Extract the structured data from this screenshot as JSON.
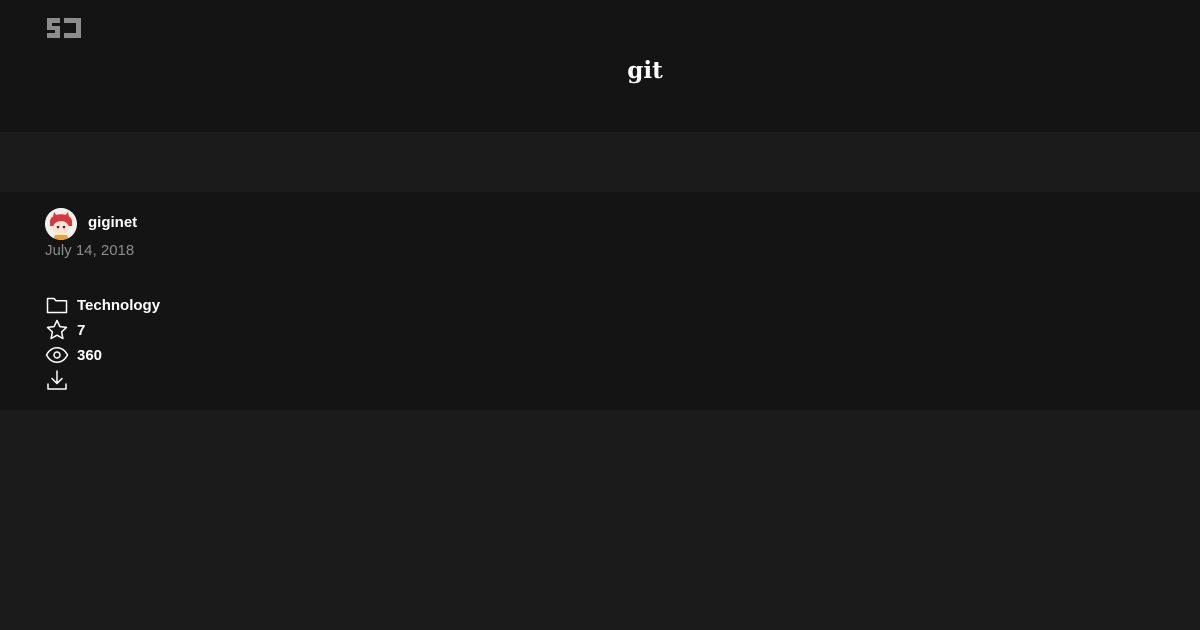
{
  "header": {
    "logo_text": "SJ",
    "title": "git"
  },
  "post": {
    "author": "giginet",
    "date": "July 14, 2018",
    "category": "Technology",
    "stars": "7",
    "views": "360",
    "icons": [
      "folder-icon",
      "star-icon",
      "eye-icon",
      "download-icon"
    ]
  },
  "colors": {
    "header_bg": "#141414",
    "page_bg": "#1b1b1b",
    "text": "#ffffff",
    "muted": "#8a8a8a"
  }
}
